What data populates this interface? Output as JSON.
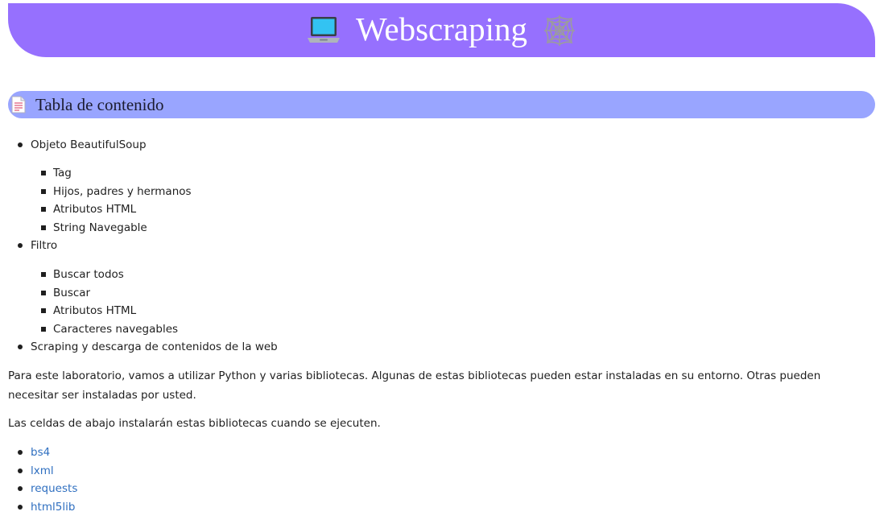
{
  "header": {
    "title": "Webscraping",
    "left_icon": "laptop-icon",
    "right_icon": "spider-web-icon",
    "background": "#9670fe"
  },
  "toc": {
    "title": "Tabla de contenido",
    "icon": "document-icon",
    "background": "#99a5ff",
    "sections": [
      {
        "label": "Objeto BeautifulSoup",
        "subitems": [
          "Tag",
          "Hijos, padres y hermanos",
          "Atributos HTML",
          "String Navegable"
        ]
      },
      {
        "label": "Filtro",
        "subitems": [
          "Buscar todos",
          "Buscar",
          "Atributos HTML",
          "Caracteres navegables"
        ]
      },
      {
        "label": "Scraping y descarga de contenidos de la web",
        "subitems": []
      }
    ]
  },
  "intro": {
    "paragraph1": "Para este laboratorio, vamos a utilizar Python y varias bibliotecas. Algunas de estas bibliotecas pueden estar instaladas en su entorno. Otras pueden necesitar ser instaladas por usted.",
    "paragraph2": "Las celdas de abajo instalarán estas bibliotecas cuando se ejecuten."
  },
  "libraries": [
    "bs4",
    "lxml",
    "requests",
    "html5lib"
  ],
  "colors": {
    "link": "#2f6fc0",
    "text": "#1f1f1f"
  }
}
